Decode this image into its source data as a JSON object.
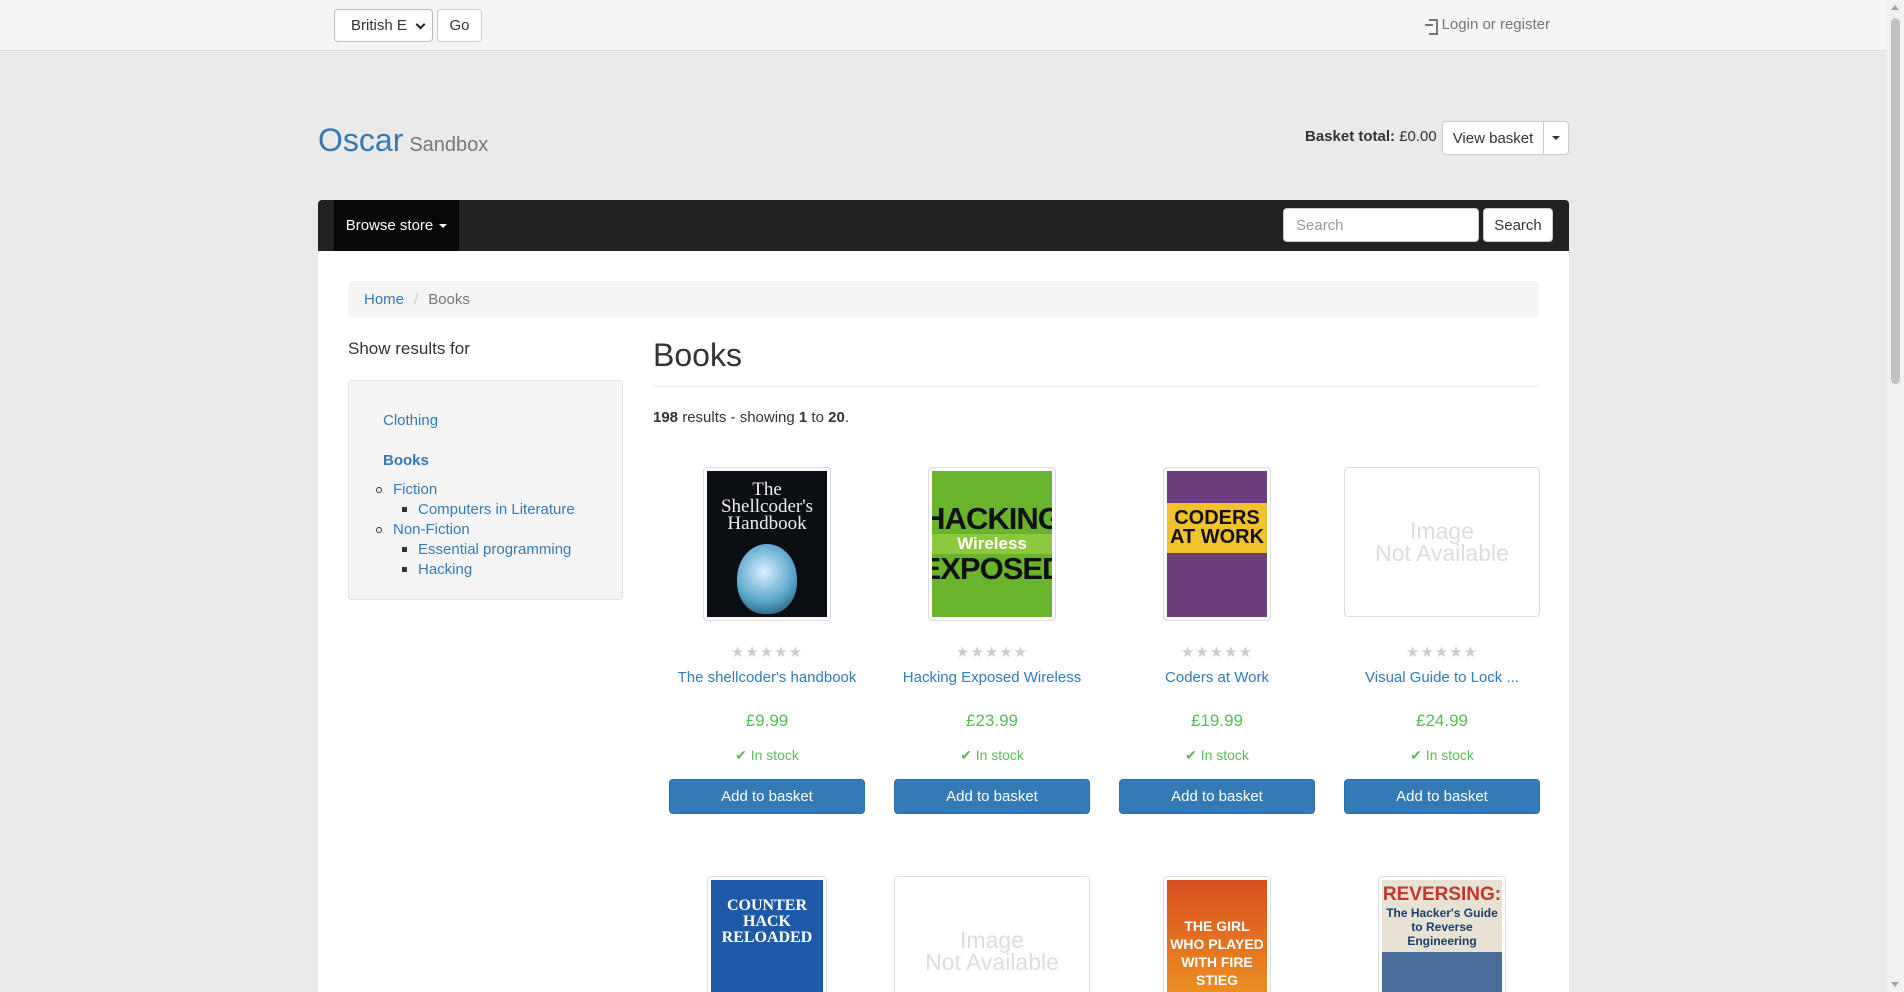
{
  "topbar": {
    "language_value": "British E",
    "go_label": "Go",
    "login_label": "Login or register"
  },
  "header": {
    "brand_name": "Oscar",
    "brand_tagline": "Sandbox",
    "basket_total_label": "Basket total:",
    "basket_total_value": "£0.00",
    "view_basket_label": "View basket"
  },
  "navbar": {
    "browse_label": "Browse store",
    "search_placeholder": "Search",
    "search_button": "Search"
  },
  "breadcrumb": {
    "home": "Home",
    "separator": "/",
    "current": "Books"
  },
  "sidebar": {
    "title": "Show results for",
    "clothing": "Clothing",
    "books": "Books",
    "fiction": "Fiction",
    "computers_in_literature": "Computers in Literature",
    "non_fiction": "Non-Fiction",
    "essential_programming": "Essential programming",
    "hacking": "Hacking"
  },
  "main": {
    "title": "Books",
    "results_count": "198",
    "results_text": " results - showing ",
    "results_from": "1",
    "results_to_word": " to ",
    "results_to": "20",
    "results_end": "."
  },
  "products": [
    {
      "title": "The shellcoder's handbook",
      "price": "£9.99",
      "stock": "In stock",
      "rating": 0,
      "cover": "The Shellcoder's Handbook"
    },
    {
      "title": "Hacking Exposed Wireless",
      "price": "£23.99",
      "stock": "In stock",
      "rating": 0,
      "cover_line1": "HACKING",
      "cover_line2": "Wireless",
      "cover_line3": "EXPOSED"
    },
    {
      "title": "Coders at Work",
      "price": "£19.99",
      "stock": "In stock",
      "rating": 0,
      "cover_line1": "CODERS",
      "cover_line2": "AT WORK"
    },
    {
      "title": "Visual Guide to Lock ...",
      "price": "£24.99",
      "stock": "In stock",
      "rating": 0,
      "image_placeholder_1": "Image",
      "image_placeholder_2": "Not Available"
    }
  ],
  "second_row": [
    {
      "cover_line1": "COUNTER HACK",
      "cover_line2": "RELOADED"
    },
    {
      "image_placeholder_1": "Image",
      "image_placeholder_2": "Not Available"
    },
    {
      "cover_line1": "THE GIRL",
      "cover_line2": "WHO PLAYED",
      "cover_line3": "WITH FIRE",
      "cover_line4": "STIEG"
    },
    {
      "cover_line1": "REVERSING:",
      "cover_line2": "The Hacker's Guide to Reverse Engineering"
    }
  ],
  "add_to_basket_label": "Add to basket",
  "stars_glyph": "★★★★★",
  "colors": {
    "link": "#337ab7",
    "price_green": "#5cb85c",
    "navbar_bg": "#222222",
    "primary_button": "#337ab7"
  }
}
